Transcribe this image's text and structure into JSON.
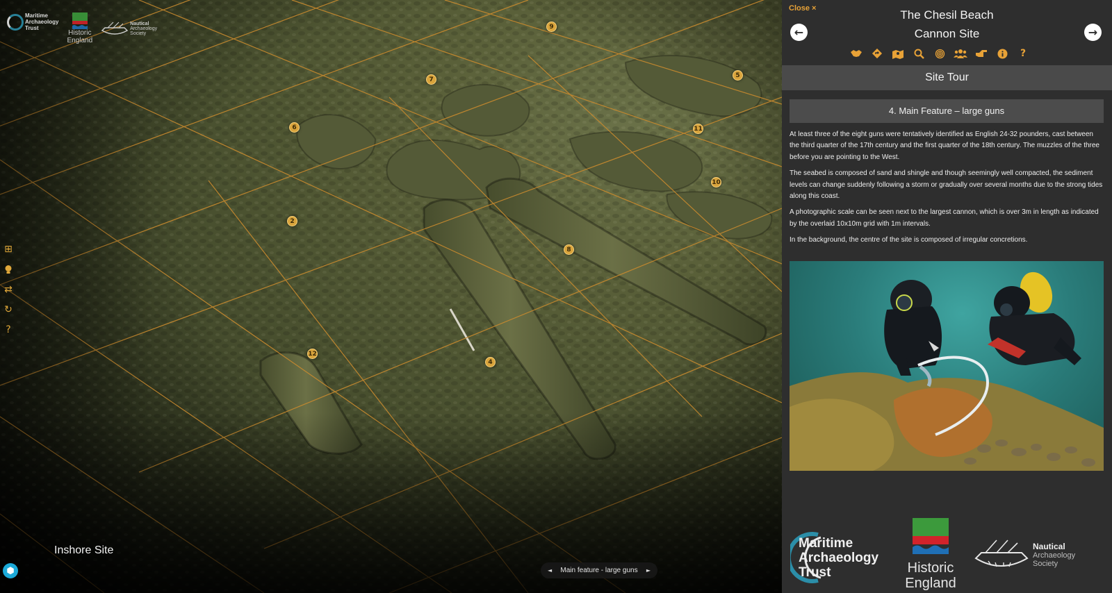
{
  "viewer": {
    "hotspots": [
      {
        "id": "9",
        "label": "9"
      },
      {
        "id": "7",
        "label": "7"
      },
      {
        "id": "5",
        "label": "5"
      },
      {
        "id": "6",
        "label": "6"
      },
      {
        "id": "11",
        "label": "11"
      },
      {
        "id": "10",
        "label": "10"
      },
      {
        "id": "2",
        "label": "2"
      },
      {
        "id": "8",
        "label": "8"
      },
      {
        "id": "12",
        "label": "12"
      },
      {
        "id": "4",
        "label": "4"
      }
    ],
    "logos": {
      "mat": "Maritime Archaeology Trust",
      "mat_lines": [
        "Maritime",
        "Archaeology",
        "Trust"
      ],
      "he_lines": [
        "Historic",
        "England"
      ],
      "nas_lines": [
        "Nautical",
        "Archaeology",
        "Society"
      ]
    },
    "tools": [
      "grid-icon",
      "lightbulb-icon",
      "swap-icon",
      "refresh-icon",
      "help-icon"
    ],
    "site_label": "Inshore Site",
    "annotation_nav": {
      "current": "Main feature - large guns",
      "prev_glyph": "◄",
      "next_glyph": "►"
    }
  },
  "panel": {
    "close_label": "Close ×",
    "title_line1": "The Chesil Beach",
    "title_line2": "Cannon Site",
    "prev_glyph": "←",
    "next_glyph": "→",
    "icons": [
      "handshake-icon",
      "direction-sign-icon",
      "map-pin-icon",
      "search-icon",
      "fingerprint-icon",
      "users-icon",
      "pointing-hand-icon",
      "info-icon",
      "question-icon"
    ],
    "section": "Site Tour",
    "feature_title": "4. Main Feature – large guns",
    "paragraphs": [
      "At least three of the eight guns were tentatively identified as English 24-32 pounders, cast between the third quarter of the 17th century and the first quarter of the 18th century. The muzzles of the three before you are pointing to the West.",
      "The seabed is composed of sand and shingle and though seemingly well compacted, the sediment levels can change suddenly following a storm or gradually over several months due to the strong tides along this coast.",
      "A photographic scale can be seen next to the largest cannon, which is over 3m in length as indicated by the overlaid 10x10m grid with 1m intervals.",
      "In the background, the centre of the site is composed of irregular concretions."
    ],
    "footer_logos": {
      "mat_lines": [
        "Maritime",
        "Archaeology",
        "Trust"
      ],
      "he_lines": [
        "Historic",
        "England"
      ],
      "nas_lines": [
        "Nautical",
        "Archaeology",
        "Society"
      ]
    }
  },
  "colors": {
    "accent": "#e8a237",
    "panel_bg": "#2e2e2e",
    "section_bg": "#4a4a4a",
    "grid_line": "#c98a2e",
    "hotspot": "#d9a43c"
  }
}
